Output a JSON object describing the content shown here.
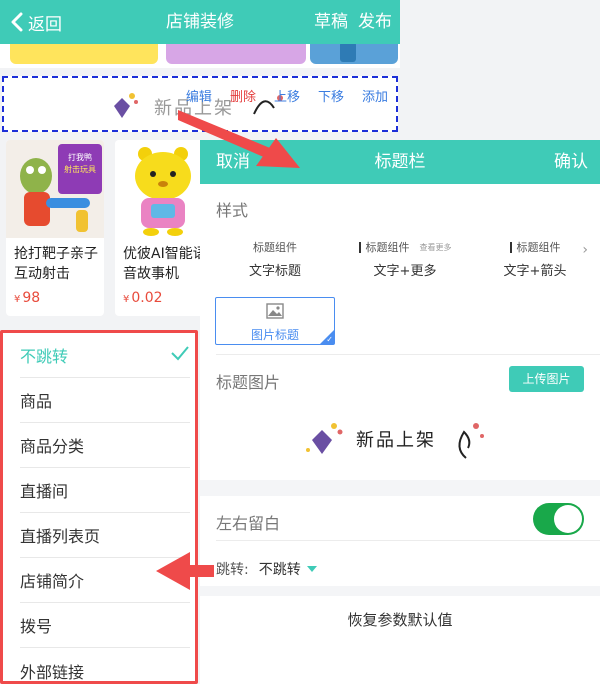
{
  "header": {
    "back_label": "返回",
    "title": "店铺装修",
    "draft_label": "草稿",
    "publish_label": "发布"
  },
  "selected_module": {
    "image_text": "新品上架",
    "actions": [
      "编辑",
      "删除",
      "上移",
      "下移",
      "添加"
    ]
  },
  "products": [
    {
      "name": "抢打靶子亲子互动射击",
      "price": "98",
      "currency": "¥",
      "badge_text": [
        "打我鸭",
        "射击玩具"
      ]
    },
    {
      "name": "优彼AI智能语音故事机",
      "price": "0.02",
      "currency": "¥"
    }
  ],
  "jump_options": {
    "selected": "不跳转",
    "items": [
      "不跳转",
      "商品",
      "商品分类",
      "直播间",
      "直播列表页",
      "店铺简介",
      "拨号",
      "外部链接"
    ]
  },
  "panel": {
    "cancel_label": "取消",
    "title": "标题栏",
    "confirm_label": "确认",
    "style_label": "样式",
    "style_options": [
      {
        "mini": "标题组件",
        "name": "文字标题"
      },
      {
        "mini": "标题组件",
        "more": "查看更多",
        "name": "文字+更多"
      },
      {
        "mini": "标题组件",
        "name": "文字+箭头"
      }
    ],
    "image_style_name": "图片标题",
    "title_image_label": "标题图片",
    "upload_label": "上传图片",
    "preview_text": "新品上架",
    "margin_label": "左右留白",
    "margin_enabled": true,
    "jump_label": "跳转:",
    "jump_value": "不跳转",
    "reset_label": "恢复参数默认值"
  },
  "colors": {
    "accent": "#3fcbb7",
    "danger": "#e43b3b",
    "link": "#3b7de0",
    "annotation": "#ef4a4a",
    "toggle_on": "#19a84a"
  }
}
